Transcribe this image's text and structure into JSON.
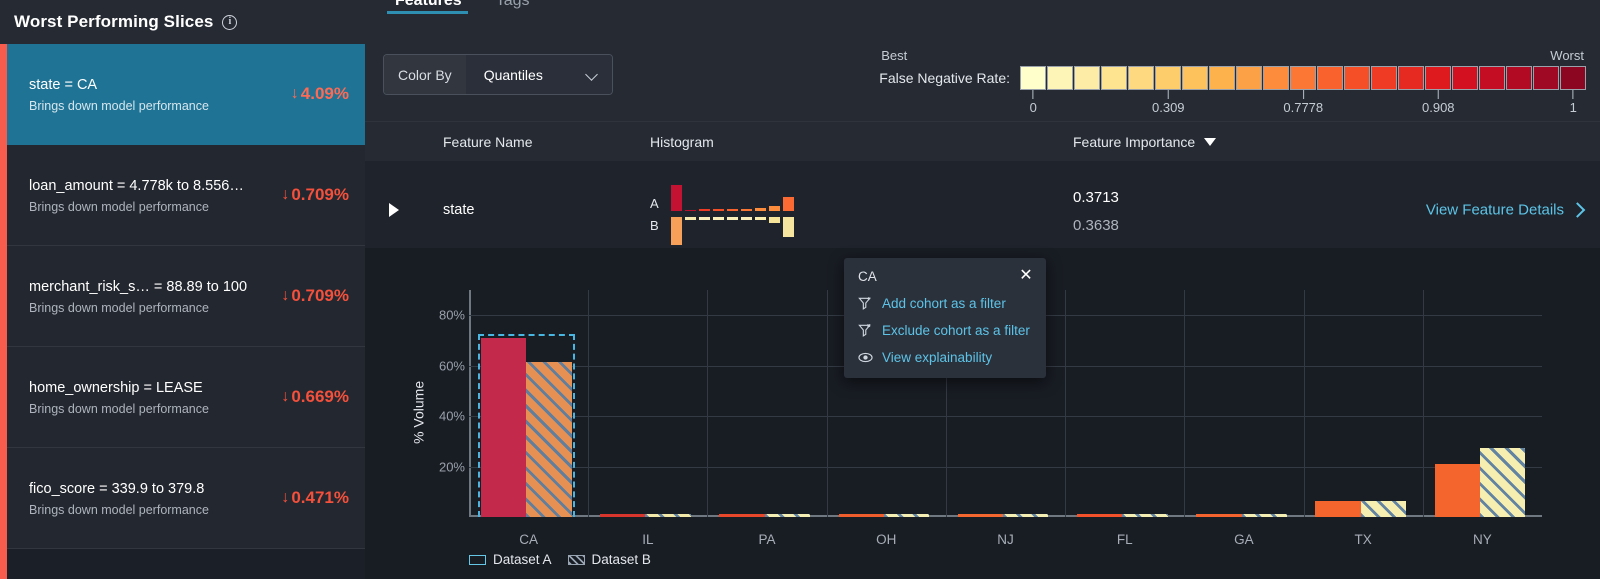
{
  "sidebar": {
    "title": "Worst Performing Slices",
    "info_icon": "info-icon",
    "slices": [
      {
        "name": "state = CA",
        "subtitle": "Brings down model performance",
        "delta": "4.09%",
        "arrow": "↓",
        "selected": true
      },
      {
        "name": "loan_amount = 4.778k to 8.556…",
        "subtitle": "Brings down model performance",
        "delta": "0.709%",
        "arrow": "↓",
        "selected": false
      },
      {
        "name": "merchant_risk_s… = 88.89 to 100",
        "subtitle": "Brings down model performance",
        "delta": "0.709%",
        "arrow": "↓",
        "selected": false
      },
      {
        "name": "home_ownership = LEASE",
        "subtitle": "Brings down model performance",
        "delta": "0.669%",
        "arrow": "↓",
        "selected": false
      },
      {
        "name": "fico_score = 339.9 to 379.8",
        "subtitle": "Brings down model performance",
        "delta": "0.471%",
        "arrow": "↓",
        "selected": false
      }
    ]
  },
  "tabs": [
    {
      "label": "Features",
      "active": true
    },
    {
      "label": "Tags",
      "active": false
    }
  ],
  "toolbar": {
    "color_by_label": "Color By",
    "color_by_value": "Quantiles",
    "chevron_icon": "chevron-down-icon"
  },
  "color_legend": {
    "metric_label": "False Negative Rate:",
    "best_label": "Best",
    "worst_label": "Worst",
    "tick_labels": [
      "0",
      "0.309",
      "0.7778",
      "0.908",
      "1"
    ],
    "tick_positions": [
      0,
      5,
      10,
      15,
      20
    ],
    "swatch_count": 21,
    "colors": [
      "#ffffcc",
      "#fdf4b8",
      "#fdeca6",
      "#fee391",
      "#fed97f",
      "#fecd6b",
      "#fec25c",
      "#feb24c",
      "#fda146",
      "#fd8d3c",
      "#fc7634",
      "#f9622c",
      "#f44f26",
      "#ef3b23",
      "#e62a21",
      "#de1a1f",
      "#d21020",
      "#c40d22",
      "#b30a23",
      "#a00924",
      "#8c0622"
    ]
  },
  "table": {
    "headers": {
      "feature_name": "Feature Name",
      "histogram": "Histogram",
      "feature_importance": "Feature Importance",
      "sort_icon": "sort-descending-caret"
    },
    "rows": [
      {
        "expander_icon": "expand-triangle-icon",
        "feature": "state",
        "hist_label_a": "A",
        "hist_label_b": "B",
        "importance_a": "0.3713",
        "importance_b": "0.3638",
        "details_link": "View Feature Details",
        "details_chevron": "chevron-right-icon",
        "hist_a": [
          {
            "h": 28,
            "color": "#c31232"
          },
          {
            "h": 3,
            "color": "#b8112b"
          },
          {
            "h": 4,
            "color": "#ef3b23"
          },
          {
            "h": 4,
            "color": "#f44f26"
          },
          {
            "h": 4,
            "color": "#f9622c"
          },
          {
            "h": 4,
            "color": "#fc7634"
          },
          {
            "h": 5,
            "color": "#fd8d3c"
          },
          {
            "h": 7,
            "color": "#fd8d3c"
          },
          {
            "h": 16,
            "color": "#fb6a33"
          }
        ],
        "hist_b": [
          {
            "h": 30,
            "color": "#f7a05a"
          },
          {
            "h": 5,
            "color": "#f7eab0"
          },
          {
            "h": 5,
            "color": "#fbf0bb"
          },
          {
            "h": 5,
            "color": "#fbf0bb"
          },
          {
            "h": 5,
            "color": "#fbf0bb"
          },
          {
            "h": 5,
            "color": "#fbf0bb"
          },
          {
            "h": 5,
            "color": "#fbeeae"
          },
          {
            "h": 8,
            "color": "#f6e49b"
          },
          {
            "h": 22,
            "color": "#f5e59f"
          }
        ]
      }
    ]
  },
  "popup": {
    "title": "CA",
    "close_icon": "close-icon",
    "items": [
      {
        "label": "Add cohort as a filter",
        "icon": "filter-add-icon"
      },
      {
        "label": "Exclude cohort as a filter",
        "icon": "filter-exclude-icon"
      },
      {
        "label": "View explainability",
        "icon": "eye-icon"
      }
    ]
  },
  "chart_data": {
    "type": "bar",
    "title": "",
    "xlabel": "",
    "ylabel": "% Volume",
    "categories": [
      "CA",
      "IL",
      "PA",
      "OH",
      "NJ",
      "FL",
      "GA",
      "TX",
      "NY"
    ],
    "ylim": [
      0,
      90
    ],
    "yticks": [
      20,
      40,
      60,
      80
    ],
    "ytick_labels": [
      "20%",
      "40%",
      "60%",
      "80%"
    ],
    "grid": true,
    "legend_position": "bottom-left",
    "selected_category": "CA",
    "series": [
      {
        "name": "Dataset A",
        "style": "solid",
        "values": [
          71,
          0.7,
          0.5,
          0.6,
          0.6,
          1.0,
          0.8,
          6.5,
          21
        ],
        "colors": [
          "#c2294a",
          "#d8352c",
          "#e8472a",
          "#f05d2c",
          "#f4672e",
          "#f2512a",
          "#f4622d",
          "#f4652e",
          "#f4652e"
        ]
      },
      {
        "name": "Dataset B",
        "style": "hatched",
        "values": [
          61.5,
          0.8,
          0.7,
          0.7,
          0.8,
          0.8,
          0.8,
          6.5,
          27.5
        ],
        "colors": [
          "#e79054",
          "#f2e9a9",
          "#f5eeb2",
          "#f5eeb2",
          "#f5eeb2",
          "#f5eeb2",
          "#f5eeb2",
          "#f6eeb0",
          "#f6eeb0"
        ]
      }
    ],
    "legend": [
      "Dataset A",
      "Dataset B"
    ]
  }
}
